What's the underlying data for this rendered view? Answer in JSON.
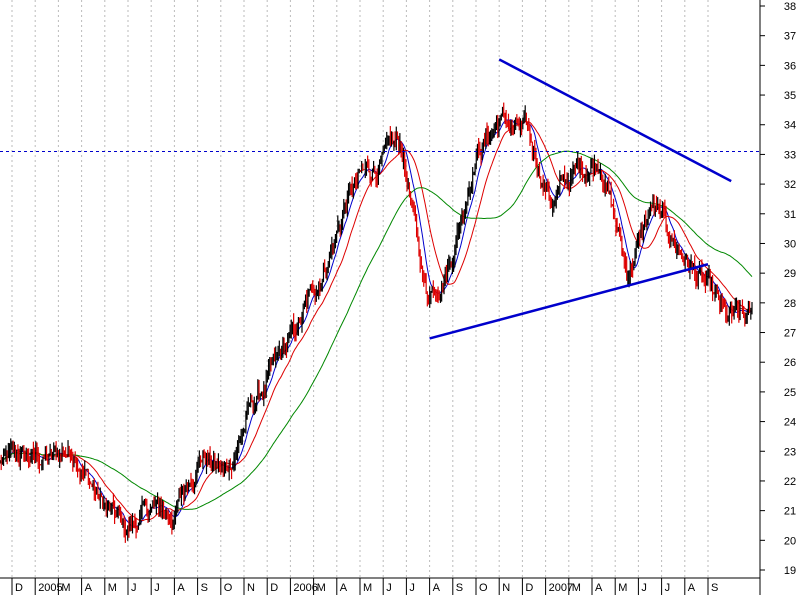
{
  "chart_data": {
    "type": "candlestick",
    "title": "",
    "xlabel": "",
    "ylabel": "",
    "ylim": [
      18.7,
      38.3
    ],
    "y_axis_side": "right",
    "grid": "vertical dotted lines at month boundaries",
    "x_tick_labels": [
      "D",
      "2005",
      "M",
      "A",
      "M",
      "J",
      "J",
      "A",
      "S",
      "O",
      "N",
      "D",
      "2006",
      "M",
      "A",
      "M",
      "J",
      "J",
      "A",
      "S",
      "O",
      "N",
      "D",
      "2007",
      "M",
      "A",
      "M",
      "J",
      "J",
      "A",
      "S"
    ],
    "y_tick_labels": [
      "19",
      "20",
      "21",
      "22",
      "23",
      "24",
      "25",
      "26",
      "27",
      "28",
      "29",
      "30",
      "31",
      "32",
      "33",
      "34",
      "35",
      "36",
      "37",
      "38"
    ],
    "price_path_monthly_closes": [
      22.6,
      22.8,
      22.7,
      23.1,
      21.3,
      20.3,
      21.0,
      20.9,
      23.0,
      22.2,
      24.4,
      25.8,
      27.3,
      29.4,
      31.8,
      32.6,
      33.3,
      28.3,
      29.6,
      33.2,
      34.2,
      33.6,
      31.5,
      32.4,
      32.9,
      29.0,
      31.2,
      29.9,
      28.7,
      27.3,
      27.4
    ],
    "series": [
      {
        "name": "",
        "color": "#cc0000",
        "style": "daily red/black price bars"
      },
      {
        "name": "",
        "color": "#0000cc",
        "style": "short moving average line"
      },
      {
        "name": "",
        "color": "#dd0000",
        "style": "medium moving average line"
      },
      {
        "name": "",
        "color": "#008800",
        "style": "long moving average line"
      }
    ],
    "annotations": [
      {
        "type": "horizontal_dashed_line",
        "y": 33.1,
        "color": "#0000cc"
      },
      {
        "type": "trendline",
        "from": {
          "x": "2006-09",
          "y": 36.2
        },
        "to": {
          "x": "2007-07",
          "y": 32.1
        },
        "color": "#0000cc"
      },
      {
        "type": "trendline",
        "from": {
          "x": "2006-06",
          "y": 26.8
        },
        "to": {
          "x": "2007-06",
          "y": 29.3
        },
        "color": "#0000cc"
      }
    ]
  }
}
